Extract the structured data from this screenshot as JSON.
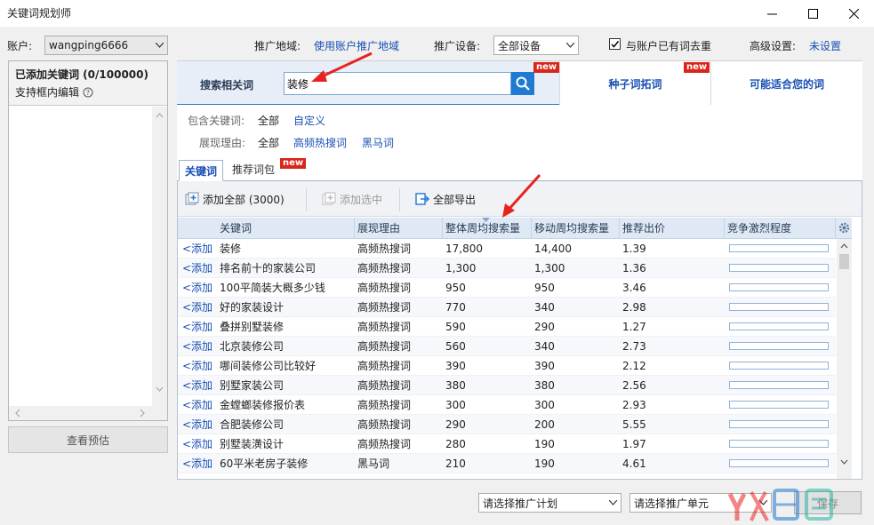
{
  "window": {
    "title": "关键词规划师"
  },
  "topbar": {
    "account_label": "账户:",
    "account_value": "wangping6666",
    "region_label": "推广地域:",
    "region_link": "使用账户推广地域",
    "device_label": "推广设备:",
    "device_value": "全部设备",
    "dedupe_checked": true,
    "dedupe_label": "与账户已有词去重",
    "advanced_label": "高级设置:",
    "advanced_link": "未设置"
  },
  "left_panel": {
    "title": "已添加关键词 (0/100000)",
    "subtitle": "支持框内编辑",
    "preview_button": "查看预估"
  },
  "search": {
    "tab_label": "搜索相关词",
    "input_value": "装修",
    "badge": "new",
    "seed_tab": "种子词拓词",
    "seed_badge": "new",
    "suggest_tab": "可能适合您的词"
  },
  "filters": {
    "include_label": "包含关键词:",
    "include_all": "全部",
    "include_custom": "自定义",
    "reason_label": "展现理由:",
    "reason_all": "全部",
    "reason_hot": "高频热搜词",
    "reason_dark": "黑马词"
  },
  "subtabs": {
    "keywords": "关键词",
    "packs": "推荐词包",
    "packs_badge": "new"
  },
  "toolbar": {
    "add_all": "添加全部 (3000)",
    "add_selected": "添加选中",
    "export_all": "全部导出"
  },
  "table": {
    "columns": [
      "关键词",
      "展现理由",
      "整体周均搜索量",
      "移动周均搜索量",
      "推荐出价",
      "竞争激烈程度"
    ],
    "add_label": "<添加",
    "rows": [
      {
        "kw": "装修",
        "reason": "高频热搜词",
        "total": "17,800",
        "mobile": "14,400",
        "bid": "1.39",
        "competition": 0.0
      },
      {
        "kw": "排名前十的家装公司",
        "reason": "高频热搜词",
        "total": "1,300",
        "mobile": "1,300",
        "bid": "1.36",
        "competition": 0.0
      },
      {
        "kw": "100平简装大概多少钱",
        "reason": "高频热搜词",
        "total": "950",
        "mobile": "950",
        "bid": "3.46",
        "competition": 0.0
      },
      {
        "kw": "好的家装设计",
        "reason": "高频热搜词",
        "total": "770",
        "mobile": "340",
        "bid": "2.98",
        "competition": 0.0
      },
      {
        "kw": "叠拼别墅装修",
        "reason": "高频热搜词",
        "total": "590",
        "mobile": "290",
        "bid": "1.27",
        "competition": 0.0
      },
      {
        "kw": "北京装修公司",
        "reason": "高频热搜词",
        "total": "560",
        "mobile": "340",
        "bid": "2.73",
        "competition": 0.0
      },
      {
        "kw": "哪间装修公司比较好",
        "reason": "高频热搜词",
        "total": "390",
        "mobile": "390",
        "bid": "2.12",
        "competition": 0.0
      },
      {
        "kw": "别墅家装公司",
        "reason": "高频热搜词",
        "total": "380",
        "mobile": "380",
        "bid": "2.56",
        "competition": 0.0
      },
      {
        "kw": "金螳螂装修报价表",
        "reason": "高频热搜词",
        "total": "300",
        "mobile": "300",
        "bid": "2.93",
        "competition": 0.0
      },
      {
        "kw": "合肥装修公司",
        "reason": "高频热搜词",
        "total": "290",
        "mobile": "200",
        "bid": "5.55",
        "competition": 0.0
      },
      {
        "kw": "别墅装潢设计",
        "reason": "高频热搜词",
        "total": "280",
        "mobile": "190",
        "bid": "1.97",
        "competition": 0.0
      },
      {
        "kw": "60平米老房子装修",
        "reason": "黑马词",
        "total": "210",
        "mobile": "190",
        "bid": "4.61",
        "competition": 0.0
      }
    ]
  },
  "bottom": {
    "plan_placeholder": "请选择推广计划",
    "unit_placeholder": "请选择推广单元",
    "save_button": "保存"
  },
  "colors": {
    "accent": "#1f7bd1",
    "link": "#1a4fb3",
    "badge": "#d9261c",
    "annotation_arrow": "#e8231f"
  }
}
